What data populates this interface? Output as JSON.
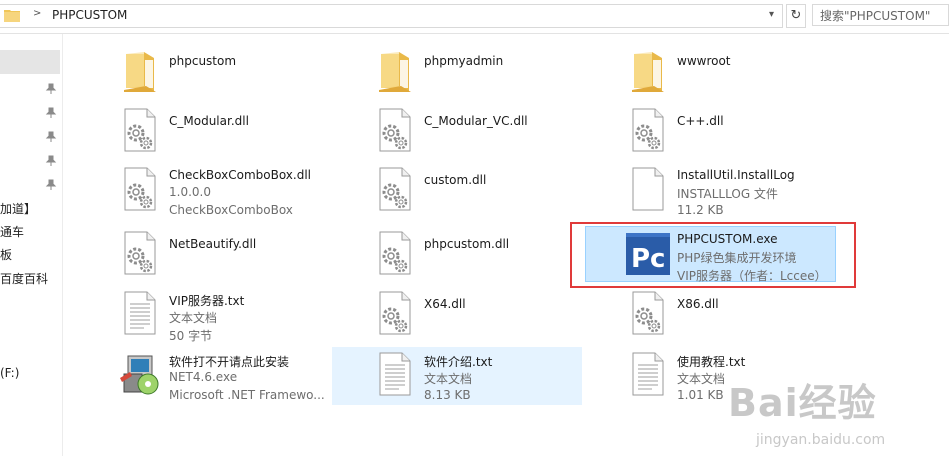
{
  "address": {
    "path": "PHPCUSTOM",
    "separator": ">"
  },
  "search": {
    "placeholder": "搜索\"PHPCUSTOM\""
  },
  "nav": {
    "labels": [
      "加道】",
      "通车",
      "板",
      "百度百科",
      "(F:)"
    ]
  },
  "files": [
    {
      "id": "phpcustom",
      "name": "phpcustom",
      "line2": "",
      "line3": "",
      "icon": "folder-icon"
    },
    {
      "id": "phpmyadmin",
      "name": "phpmyadmin",
      "line2": "",
      "line3": "",
      "icon": "folder-icon"
    },
    {
      "id": "wwwroot",
      "name": "wwwroot",
      "line2": "",
      "line3": "",
      "icon": "folder-icon"
    },
    {
      "id": "c-modular",
      "name": "C_Modular.dll",
      "line2": "",
      "line3": "",
      "icon": "dll-gear-icon"
    },
    {
      "id": "c-modular-vc",
      "name": "C_Modular_VC.dll",
      "line2": "",
      "line3": "",
      "icon": "dll-gear-icon"
    },
    {
      "id": "cpp",
      "name": "C++.dll",
      "line2": "",
      "line3": "",
      "icon": "dll-gear-icon"
    },
    {
      "id": "checkbox",
      "name": "CheckBoxComboBox.dll",
      "line2": "1.0.0.0",
      "line3": "CheckBoxComboBox",
      "icon": "dll-gear-icon"
    },
    {
      "id": "custom",
      "name": "custom.dll",
      "line2": "",
      "line3": "",
      "icon": "dll-gear-icon"
    },
    {
      "id": "installutil",
      "name": "InstallUtil.InstallLog",
      "line2": "INSTALLLOG 文件",
      "line3": "11.2 KB",
      "icon": "blank-file-icon"
    },
    {
      "id": "netbeautify",
      "name": "NetBeautify.dll",
      "line2": "",
      "line3": "",
      "icon": "dll-gear-icon"
    },
    {
      "id": "phpcustomdll",
      "name": "phpcustom.dll",
      "line2": "",
      "line3": "",
      "icon": "dll-gear-icon"
    },
    {
      "id": "phpcustomexe",
      "name": "PHPCUSTOM.exe",
      "line2": "PHP绿色集成开发环境",
      "line3": "VIP服务器（作者：Lccee）",
      "icon": "pc-app-icon"
    },
    {
      "id": "vip",
      "name": "VIP服务器.txt",
      "line2": "文本文档",
      "line3": "50 字节",
      "icon": "text-file-icon"
    },
    {
      "id": "x64",
      "name": "X64.dll",
      "line2": "",
      "line3": "",
      "icon": "dll-gear-icon"
    },
    {
      "id": "x86",
      "name": "X86.dll",
      "line2": "",
      "line3": "",
      "icon": "dll-gear-icon"
    },
    {
      "id": "net46",
      "name": "软件打不开请点此安装",
      "line2": "NET4.6.exe",
      "line3": "Microsoft .NET Framewo...",
      "icon": "installer-icon"
    },
    {
      "id": "intro",
      "name": "软件介绍.txt",
      "line2": "文本文档",
      "line3": "8.13 KB",
      "icon": "text-file-icon"
    },
    {
      "id": "tutorial",
      "name": "使用教程.txt",
      "line2": "文本文档",
      "line3": "1.01 KB",
      "icon": "text-file-icon"
    }
  ],
  "watermark": {
    "brand": "Bai经验",
    "url": "jingyan.baidu.com"
  },
  "colors": {
    "selection": "#cce8ff",
    "hover": "#e5f3ff",
    "highlight_border": "#e03a3a",
    "folder": "#f0c658"
  }
}
